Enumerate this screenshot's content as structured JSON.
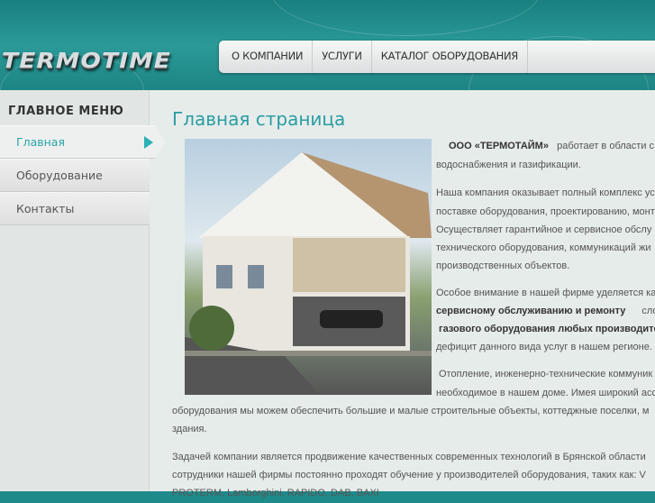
{
  "header": {
    "logo": "TERMOTIME"
  },
  "nav": [
    {
      "label": "О КОМПАНИИ"
    },
    {
      "label": "УСЛУГИ"
    },
    {
      "label": "КАТАЛОГ ОБОРУДОВАНИЯ"
    }
  ],
  "sidebar": {
    "title": "ГЛАВНОЕ МЕНЮ",
    "items": [
      {
        "label": "Главная"
      },
      {
        "label": "Оборудование"
      },
      {
        "label": "Контакты"
      }
    ]
  },
  "main": {
    "title": "Главная страница",
    "p1": {
      "company": "ООО «ТЕРМОТАЙМ»",
      "l1": "работает в области с",
      "l2": "водоснабжения   и   газификации."
    },
    "p2": [
      "Наша компания оказывает полный комплекс ус",
      "поставке оборудования, проектированию, монт",
      "Осуществляет гарантийное и сервисное обслу",
      "технического оборудования, коммуникаций жи",
      "производственных объектов."
    ],
    "p3": {
      "l1": "Особое внимание в нашей фирме уделяется ка",
      "bold1": "сервисному обслуживанию и ремонту",
      "l2tail": "сло",
      "bold2": "газового оборудования любых производите",
      "l4": "дефицит данного вида услуг в нашем регионе."
    },
    "p4": [
      "Отопление, инженерно-технические коммуник",
      "необходимое в нашем доме. Имея широкий асс",
      "оборудования мы можем обеспечить большие и малые строительные объекты, коттеджные поселки, м",
      "здания."
    ],
    "p5": [
      "Задачей компании является продвижение качественных современных технологий в Брянской области",
      "сотрудники нашей фирмы постоянно проходят обучение у производителей оборудования, таких как: V",
      "PROTERM, Lamborghini, RAPIDO, DAB, BAXI"
    ]
  }
}
